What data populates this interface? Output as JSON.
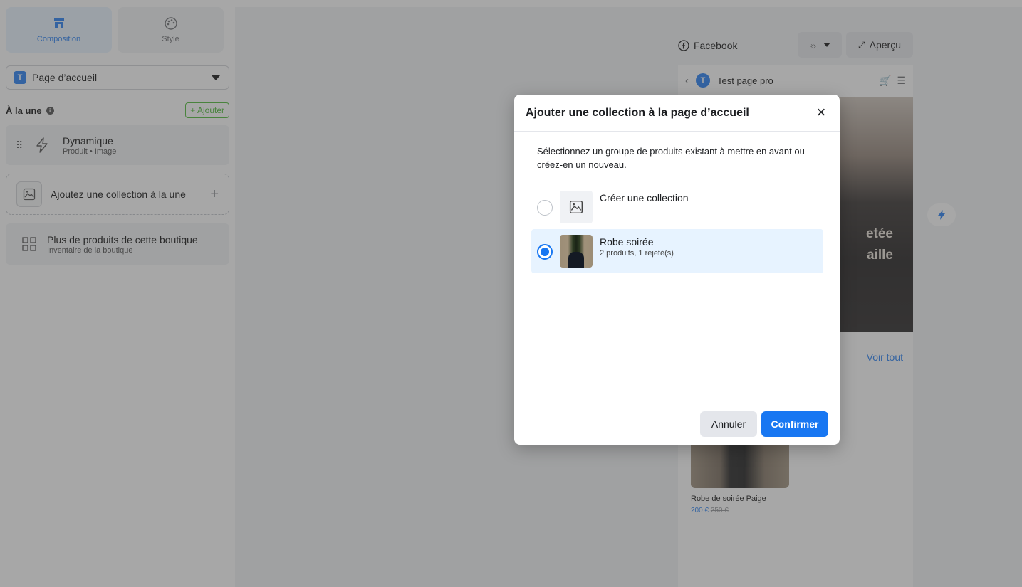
{
  "tabs": [
    {
      "label": "Composition",
      "icon": "storefront-icon",
      "active": true
    },
    {
      "label": "Style",
      "icon": "palette-icon",
      "active": false
    }
  ],
  "page_select": {
    "badge": "T",
    "value": "Page d’accueil"
  },
  "featured": {
    "title": "À la une",
    "add_label": "+ Ajouter",
    "items": [
      {
        "title": "Dynamique",
        "subtitle": "Produit • Image",
        "icon": "lightning-icon"
      }
    ],
    "add_collection_label": "Ajoutez une collection à la une"
  },
  "more_products": {
    "title": "Plus de produits de cette boutique",
    "subtitle": "Inventaire de la boutique"
  },
  "preview": {
    "channel": "Facebook",
    "apercu_label": "Aperçu",
    "page_badge": "T",
    "page_name": "Test page pro",
    "hero_text_1": "etée",
    "hero_text_2": "aille",
    "see_all": "Voir tout",
    "product_name": "Robe de soirée Paige",
    "price_current": "200 €",
    "price_old": "250 €"
  },
  "modal": {
    "title": "Ajouter une collection à la page d’accueil",
    "description": "Sélectionnez un groupe de produits existant à mettre en avant ou créez-en un nouveau.",
    "options": [
      {
        "title": "Créer une collection",
        "subtitle": "",
        "selected": false
      },
      {
        "title": "Robe soirée",
        "subtitle": "2 produits, 1 rejeté(s)",
        "selected": true
      }
    ],
    "cancel_label": "Annuler",
    "confirm_label": "Confirmer"
  },
  "colors": {
    "accent": "#1877f2",
    "add_green": "#42b72a",
    "selected_bg": "#e7f3ff"
  }
}
